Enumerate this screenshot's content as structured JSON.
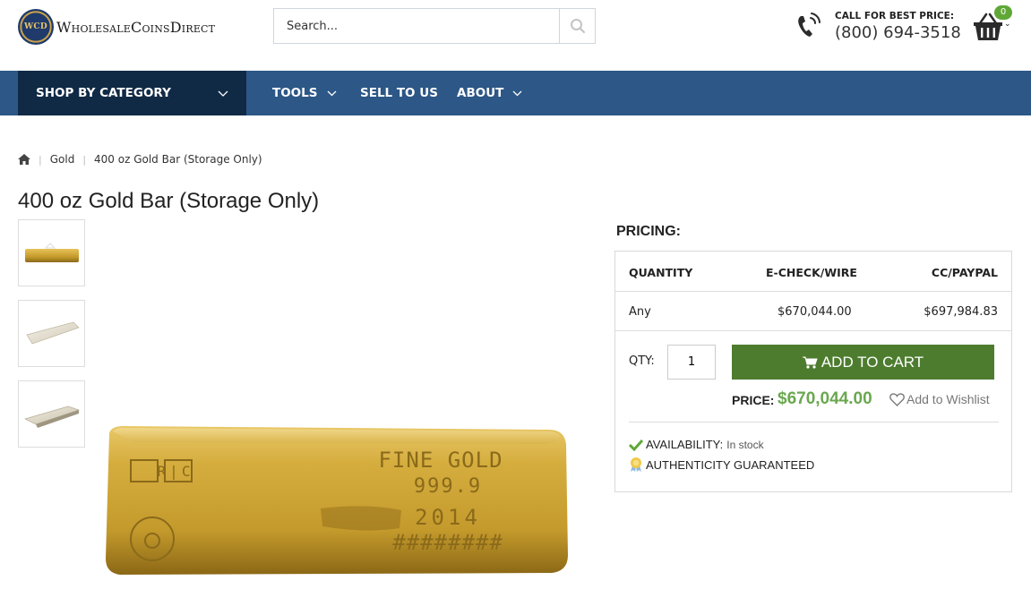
{
  "header": {
    "logo_seal_text": "WCD",
    "logo_text": "WholesaleCoinsDirect",
    "search_placeholder": "Search...",
    "call_label": "CALL FOR BEST PRICE:",
    "call_number": "(800) 694-3518",
    "cart_count": "0"
  },
  "nav": {
    "shop_by_category": "SHOP BY CATEGORY",
    "items": [
      {
        "label": "TOOLS"
      },
      {
        "label": "SELL TO US"
      },
      {
        "label": "ABOUT"
      }
    ]
  },
  "breadcrumb": {
    "items": [
      "Gold",
      "400 oz Gold Bar (Storage Only)"
    ]
  },
  "product": {
    "title": "400 oz Gold Bar (Storage Only)",
    "bar_stamp": {
      "logo": "R|C",
      "line1": "FINE GOLD",
      "line2": "999.9",
      "line3": "2014",
      "line4": "########"
    }
  },
  "pricing": {
    "label": "PRICING:",
    "headers": [
      "QUANTITY",
      "E-CHECK/WIRE",
      "CC/PAYPAL"
    ],
    "rows": [
      {
        "quantity": "Any",
        "echeck": "$670,044.00",
        "cc": "$697,984.83"
      }
    ],
    "qty_label": "QTY:",
    "qty_value": "1",
    "add_to_cart": "ADD TO CART",
    "price_label": "PRICE:",
    "price_value": "$670,044.00",
    "wishlist": "Add to Wishlist",
    "availability_label": "AVAILABILITY:",
    "availability_value": "In stock",
    "authenticity": "AUTHENTICITY GUARANTEED"
  },
  "colors": {
    "nav_bg": "#2c5786",
    "shop_cat_bg": "#102a45",
    "add_to_cart_bg": "#4d7c2f",
    "price_green": "#6aa84f",
    "cart_badge": "#5fa836"
  }
}
